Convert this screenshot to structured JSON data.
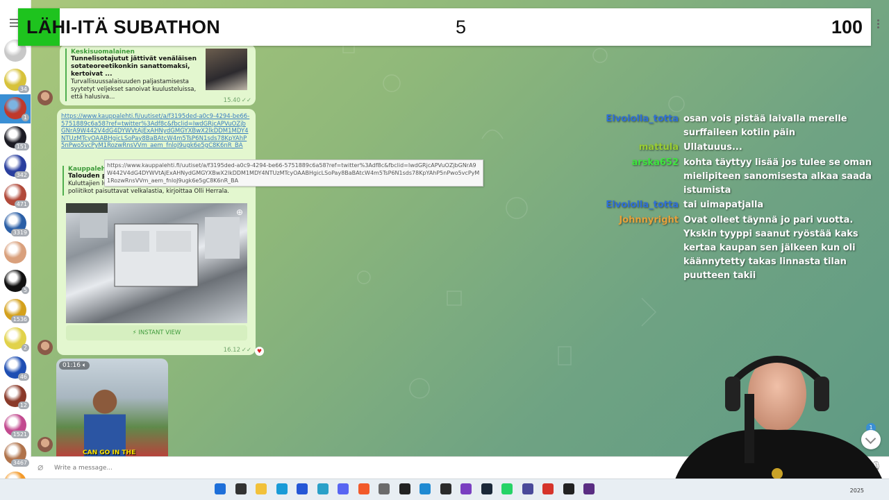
{
  "banner": {
    "title": "LÄHI-ITÄ SUBATHON",
    "count1": "5",
    "count2": "100"
  },
  "sidebar": {
    "badges": [
      "",
      "34",
      "1",
      "151",
      "342",
      "471",
      "3319",
      "",
      "5",
      "1536",
      "2",
      "46",
      "12",
      "1521",
      "3467",
      ""
    ]
  },
  "messages": {
    "m1": {
      "source": "Keskisuomalainen",
      "title": "Tunnelisotajutut jättivät venäläisen sotateoreetikonkin sanattomaksi, kertoivat ...",
      "text": "Turvallisuussalaisuuden paljastamisesta syytetyt veljekset sanoivat kuulusteluissa, että halusiva...",
      "time": "15.40"
    },
    "m2": {
      "link": "https://www.kauppalehti.fi/uutiset/a/f3195ded-a0c9-4294-be66-5751889c6a58?ref=twitter%3Adf8c&fbclid=IwdGRjcAPVuOZjbGNrA9W442V4dG4DYWVtAjExAHNydGMGYXBwX2lkDDM1MDY4NTUzMTcyOAABHgicLSoPay8BaBAtcW4m5TsP6N1sds78KpYAhP5nPwo5vcPyM1RozwRnsVVm_aem_fnloJ9ugk6e5gC8K6nR_BA",
      "source": "Kauppalehti",
      "title": "Talouden pila...",
      "text": "Kuluttajien luottamus rakoilee, koska talous ei kasva ja poliitikot paisuttavat velkalastia, kirjoittaa Olli Herrala.",
      "instant_view": "⚡ INSTANT VIEW",
      "time": "16.12"
    },
    "m3": {
      "duration": "01:16",
      "caption": "CAN GO IN THE"
    }
  },
  "tooltip": "https://www.kauppalehti.fi/uutiset/a/f3195ded-a0c9-4294-be66-5751889c6a58?ref=twitter%3Adf8c&fbclid=IwdGRjcAPVuOZjbGNrA9W442V4dG4DYWVtAjExAHNydGMGYXBwX2lkDDM1MDY4NTUzMTcyOAABHgicLSoPay8BaBAtcW4m5TsP6N1sds78KpYAhP5nPwo5vcPyM1RozwRnsVVm_aem_fnloJ9ugk6e5gC8K6nR_BA",
  "chat": [
    {
      "user": "Elvoiolla_totta",
      "color": "#2f6fd6",
      "text": "osan vois pistää laivalla merelle surffaileen kotiin päin"
    },
    {
      "user": "mattula",
      "color": "#9acd32",
      "text": "Ullatuuus..."
    },
    {
      "user": "arska652",
      "color": "#3ee63e",
      "text": "kohta täyttyy lisää jos tulee se oman mielipiteen sanomisesta alkaa saada istumista"
    },
    {
      "user": "Elvoiolla_totta",
      "color": "#2f6fd6",
      "text": "tai uimapatjalla"
    },
    {
      "user": "Johnnyright",
      "color": "#e6a23c",
      "text": "Ovat olleet täynnä jo pari vuotta. Ykskin tyyppi saanut ryöstää kaks kertaa kaupan sen jälkeen kun oli käännytetty takas linnasta tilan puutteen takii"
    }
  ],
  "input": {
    "placeholder": "Write a message..."
  },
  "scroll_badge": "1",
  "taskbar": {
    "year": "2025"
  }
}
